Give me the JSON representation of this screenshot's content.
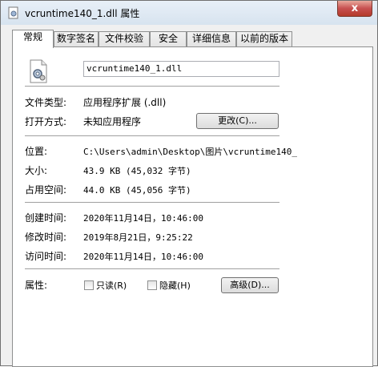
{
  "window": {
    "title": "vcruntime140_1.dll 属性",
    "close_label": "x"
  },
  "tabs": [
    {
      "label": "常规",
      "active": true
    },
    {
      "label": "数字签名"
    },
    {
      "label": "文件校验"
    },
    {
      "label": "安全"
    },
    {
      "label": "详细信息"
    },
    {
      "label": "以前的版本"
    }
  ],
  "general": {
    "file_icon": "dll-file-gear-icon",
    "filename": "vcruntime140_1.dll",
    "type_label": "文件类型:",
    "type_value": "应用程序扩展 (.dll)",
    "opens_label": "打开方式:",
    "opens_value": "未知应用程序",
    "change_button": "更改(C)...",
    "location_label": "位置:",
    "location_value": "C:\\Users\\admin\\Desktop\\图片\\vcruntime140_",
    "size_label": "大小:",
    "size_value": "43.9 KB (45,032 字节)",
    "disk_size_label": "占用空间:",
    "disk_size_value": "44.0 KB (45,056 字节)",
    "created_label": "创建时间:",
    "created_value": "2020年11月14日，10:46:00",
    "modified_label": "修改时间:",
    "modified_value": "2019年8月21日，9:25:22",
    "accessed_label": "访问时间:",
    "accessed_value": "2020年11月14日，10:46:00",
    "attributes_label": "属性:",
    "readonly_label": "只读(R)",
    "readonly_checked": false,
    "hidden_label": "隐藏(H)",
    "hidden_checked": false,
    "advanced_button": "高级(D)..."
  }
}
